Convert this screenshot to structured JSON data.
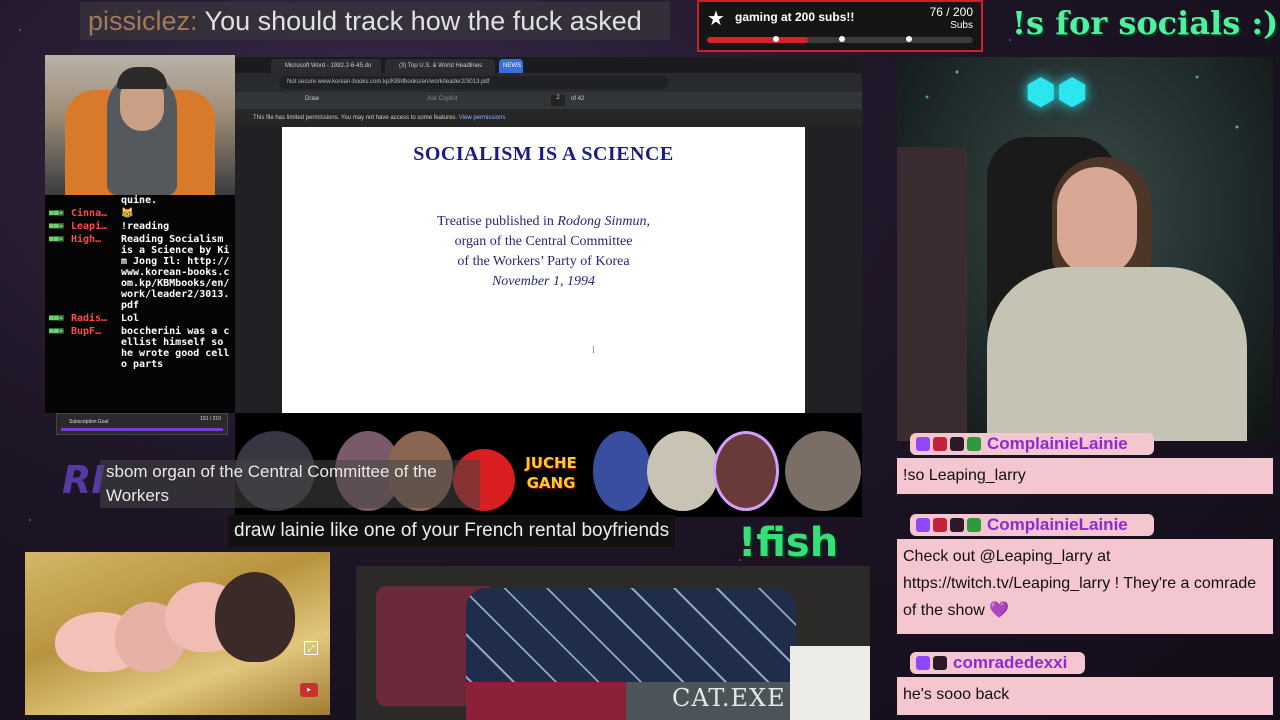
{
  "top_chat": {
    "user": "pissiclez:",
    "text": " You should track how the fuck asked"
  },
  "sub_goal": {
    "title": "gaming at 200 subs!!",
    "count": "76 / 200",
    "unit": "Subs",
    "progress": 0.38
  },
  "socials_text": "!s for socials :)",
  "left_chat": {
    "messages": [
      {
        "name": "",
        "text": "quine."
      },
      {
        "name": "Cinna…",
        "text": "😹"
      },
      {
        "name": "Leapi…",
        "text": "!reading"
      },
      {
        "name": "High…",
        "text": "Reading Socialism is a Science by Kim Jong Il: http://www.korean-books.com.kp/KBMbooks/en/work/leader2/3013.pdf"
      },
      {
        "name": "Radis…",
        "text": "Lol"
      },
      {
        "name": "BupF…",
        "text": "boccherini was a cellist himself so he wrote good cello parts"
      }
    ]
  },
  "mini_subbar": {
    "label": "Subscription Goal",
    "count": "191 / 210",
    "unit": "Subs"
  },
  "browser": {
    "tabs": [
      "Microsoft Word - 1992.2-6-45.do",
      "(3) Top U.S. & World Headlines",
      "NEWS"
    ],
    "url": "Not secure  www.korean-books.com.kp/KBMbooks/en/work/leader2/3013.pdf",
    "toolbar": {
      "draw": "Draw",
      "ask": "Ask Copilot",
      "page": "2",
      "of": "of 42"
    },
    "permission": "This file has limited permissions. You may not have access to some features.",
    "permission_link": "View permissions",
    "doc": {
      "title": "SOCIALISM IS A SCIENCE",
      "line1": "Treatise published in ",
      "line1_em": "Rodong Sinmun",
      "line1_end": ",",
      "line2": "organ of the Central Committee",
      "line3": "of the Workers’ Party of Korea",
      "date": "November 1, 1994"
    }
  },
  "juche_text": "JUCHE GANG",
  "logo_text": "RI",
  "caption1": "sbom organ of the Central Committee of the Workers",
  "caption2": "draw lainie like one of your French rental boyfriends",
  "fish_text": "!fish",
  "cat_label": "CAT.EXE",
  "right_chat": [
    {
      "name": "ComplainieLainie",
      "text": "!so Leaping_larry"
    },
    {
      "name": "ComplainieLainie",
      "text": "Check out @Leaping_larry at https://twitch.tv/Leaping_larry ! They're a comrade of the show 💜"
    },
    {
      "name": "comradedexxi",
      "text": "he's sooo back"
    }
  ],
  "colors": {
    "accent_green": "#33e07a",
    "goal_red": "#d6242c",
    "twitch_purple": "#9146ff",
    "card_pink": "#f4c6cf"
  }
}
